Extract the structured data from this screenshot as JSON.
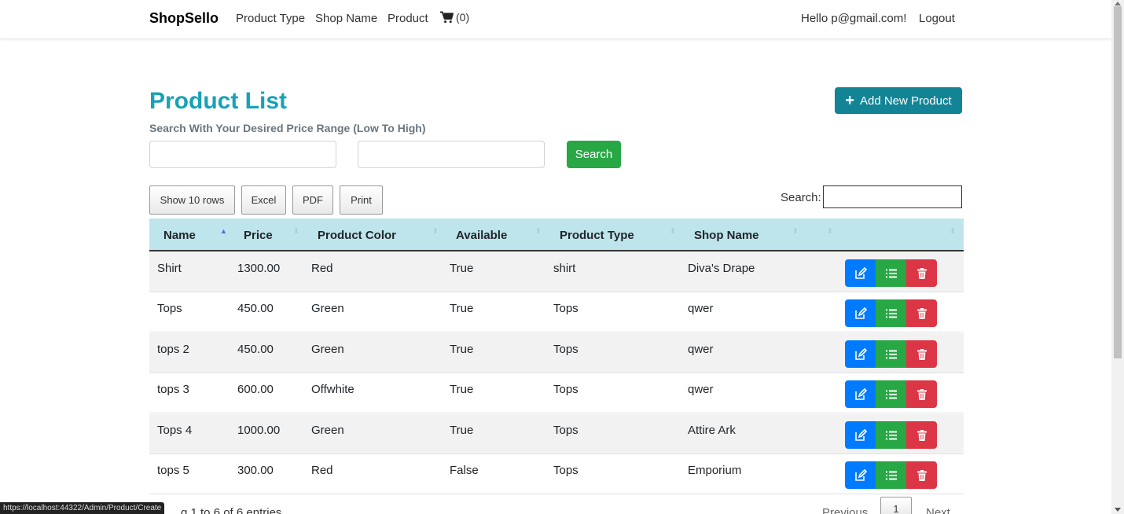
{
  "nav": {
    "brand": "ShopSello",
    "links": [
      "Product Type",
      "Shop Name",
      "Product"
    ],
    "cart_count": "(0)",
    "greeting": "Hello p@gmail.com!",
    "logout": "Logout"
  },
  "page": {
    "title": "Product List",
    "subtitle": "Search With Your Desired Price Range (Low To High)",
    "add_button": "Add New Product",
    "search_button": "Search"
  },
  "toolbar": {
    "buttons": [
      "Show 10 rows",
      "Excel",
      "PDF",
      "Print"
    ],
    "search_label": "Search:"
  },
  "table": {
    "columns": [
      "Name",
      "Price",
      "Product Color",
      "Available",
      "Product Type",
      "Shop Name"
    ],
    "rows": [
      [
        "Shirt",
        "1300.00",
        "Red",
        "True",
        "shirt",
        "Diva's Drape"
      ],
      [
        "Tops",
        "450.00",
        "Green",
        "True",
        "Tops",
        "qwer"
      ],
      [
        "tops 2",
        "450.00",
        "Green",
        "True",
        "Tops",
        "qwer"
      ],
      [
        "tops 3",
        "600.00",
        "Offwhite",
        "True",
        "Tops",
        "qwer"
      ],
      [
        "Tops 4",
        "1000.00",
        "Green",
        "True",
        "Tops",
        "Attire Ark"
      ],
      [
        "tops 5",
        "300.00",
        "Red",
        "False",
        "Tops",
        "Emporium"
      ]
    ]
  },
  "footer": {
    "info": "g 1 to 6 of 6 entries",
    "previous": "Previous",
    "current_page": "1",
    "next": "Next"
  },
  "status_bar": {
    "url": "https://localhost:44322/Admin/Product/Create"
  },
  "colors": {
    "title": "#17a2b8",
    "add_button": "#138496",
    "search_button": "#28a745",
    "edit": "#007bff",
    "detail": "#28a745",
    "delete": "#dc3545",
    "header_bg": "#bee5eb"
  }
}
